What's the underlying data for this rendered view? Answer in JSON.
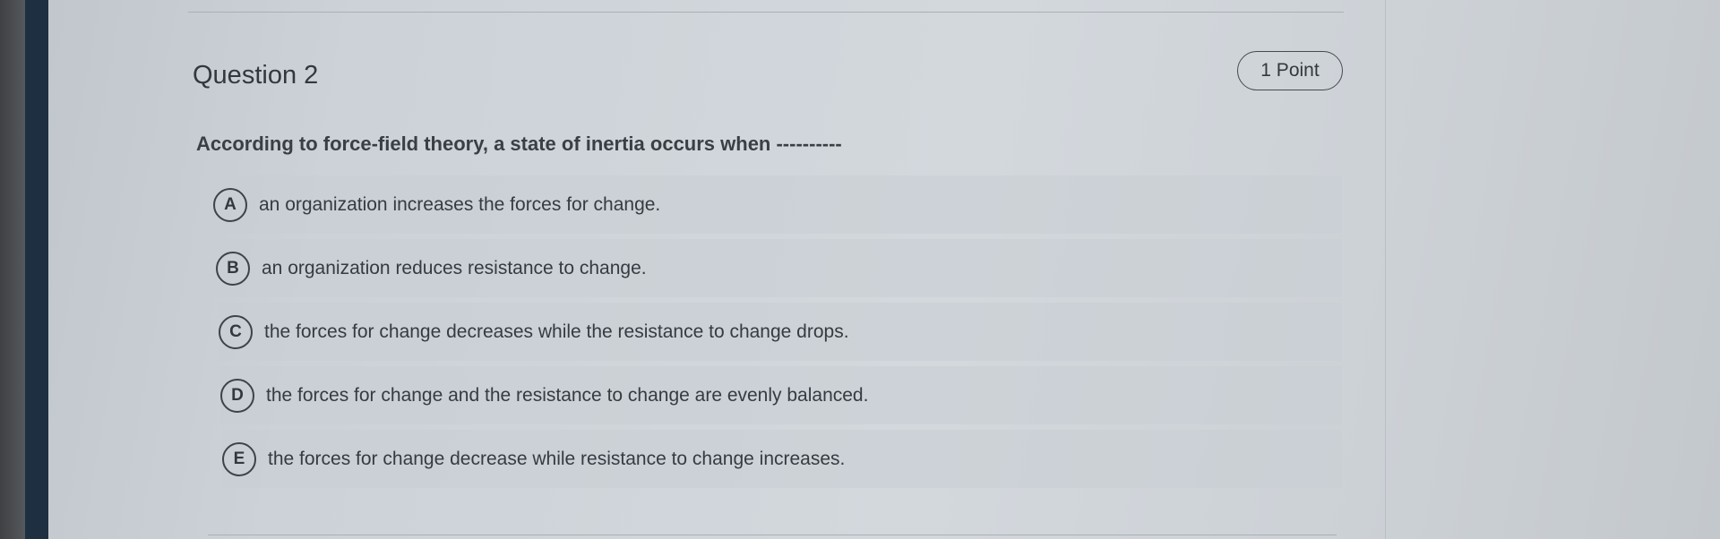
{
  "question": {
    "title": "Question 2",
    "points": "1 Point",
    "prompt": "According to force-field theory, a state of inertia occurs when ----------"
  },
  "options": [
    {
      "letter": "A",
      "text": "an organization increases the forces for change."
    },
    {
      "letter": "B",
      "text": "an organization reduces resistance to change."
    },
    {
      "letter": "C",
      "text": "the forces for change decreases while the resistance to change drops."
    },
    {
      "letter": "D",
      "text": "the forces for change and the resistance to change are evenly balanced."
    },
    {
      "letter": "E",
      "text": "the forces for change decrease while resistance to change increases."
    }
  ]
}
